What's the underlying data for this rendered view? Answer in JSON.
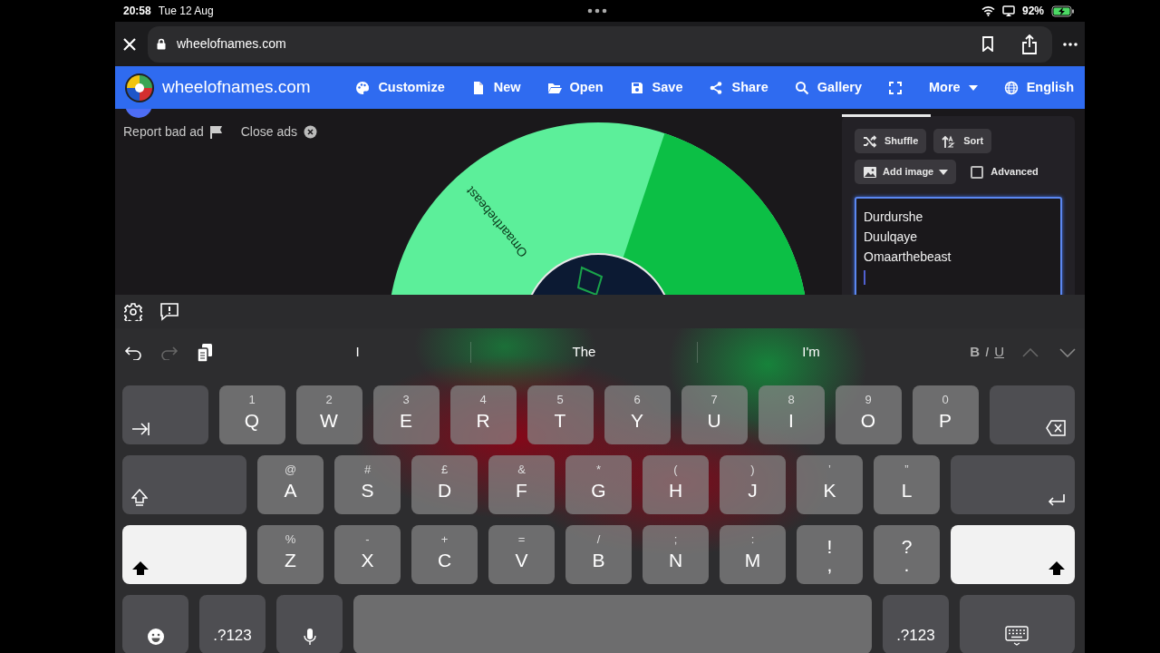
{
  "status_bar": {
    "time": "20:58",
    "date": "Tue 12 Aug",
    "battery": "92%"
  },
  "browser": {
    "url": "wheelofnames.com"
  },
  "site": {
    "logo_text": "wheelofnames.com",
    "menu": [
      {
        "label": "Customize",
        "kind": "palette"
      },
      {
        "label": "New",
        "kind": "file"
      },
      {
        "label": "Open",
        "kind": "folder"
      },
      {
        "label": "Save",
        "kind": "save"
      },
      {
        "label": "Share",
        "kind": "share"
      },
      {
        "label": "Gallery",
        "kind": "search"
      },
      {
        "kind": "fullscreen"
      },
      {
        "label": "More",
        "kind": "more"
      },
      {
        "label": "English",
        "kind": "globe"
      }
    ]
  },
  "ad_bar": [
    {
      "label": "Report bad ad",
      "kind": "flag"
    },
    {
      "label": "Close ads",
      "kind": "close"
    }
  ],
  "wheel": {
    "segments": [
      {
        "label": "Omaarthebeast",
        "color": "#5cef9a"
      },
      {
        "color": "#0cbf45"
      }
    ]
  },
  "editor": {
    "buttons": [
      {
        "label": "Shuffle",
        "kind": "shuffle"
      },
      {
        "label": "Sort",
        "kind": "sort"
      },
      {
        "label": "Add image",
        "kind": "image"
      }
    ],
    "advanced": {
      "label": "Advanced",
      "checked": false
    },
    "entries": [
      "Durdurshe",
      "Duulqaye",
      "Omaarthebeast"
    ]
  },
  "predictions": [
    "I",
    "The",
    "I'm"
  ],
  "format_buttons": [
    {
      "label": "B",
      "kind": "bold"
    },
    {
      "label": "I",
      "kind": "italic"
    },
    {
      "label": "U",
      "kind": "underline"
    }
  ],
  "keyboard": {
    "rows": [
      {
        "keys": [
          {
            "kind": "tab"
          },
          {
            "kind": "letter",
            "label": "Q",
            "sub": "1"
          },
          {
            "kind": "letter",
            "label": "W",
            "sub": "2"
          },
          {
            "kind": "letter",
            "label": "E",
            "sub": "3"
          },
          {
            "kind": "letter",
            "label": "R",
            "sub": "4"
          },
          {
            "kind": "letter",
            "label": "T",
            "sub": "5"
          },
          {
            "kind": "letter",
            "label": "Y",
            "sub": "6"
          },
          {
            "kind": "letter",
            "label": "U",
            "sub": "7"
          },
          {
            "kind": "letter",
            "label": "I",
            "sub": "8"
          },
          {
            "kind": "letter",
            "label": "O",
            "sub": "9"
          },
          {
            "kind": "letter",
            "label": "P",
            "sub": "0"
          },
          {
            "kind": "delete"
          }
        ]
      },
      {
        "keys": [
          {
            "kind": "capslock"
          },
          {
            "kind": "letter",
            "label": "A",
            "sub": "@"
          },
          {
            "kind": "letter",
            "label": "S",
            "sub": "#"
          },
          {
            "kind": "letter",
            "label": "D",
            "sub": "£"
          },
          {
            "kind": "letter",
            "label": "F",
            "sub": "&"
          },
          {
            "kind": "letter",
            "label": "G",
            "sub": "*"
          },
          {
            "kind": "letter",
            "label": "H",
            "sub": "("
          },
          {
            "kind": "letter",
            "label": "J",
            "sub": ")"
          },
          {
            "kind": "letter",
            "label": "K",
            "sub": "’"
          },
          {
            "kind": "letter",
            "label": "L",
            "sub": "”"
          },
          {
            "kind": "return"
          }
        ]
      },
      {
        "keys": [
          {
            "kind": "shift",
            "on": true
          },
          {
            "kind": "letter",
            "label": "Z",
            "sub": "%"
          },
          {
            "kind": "letter",
            "label": "X",
            "sub": "-"
          },
          {
            "kind": "letter",
            "label": "C",
            "sub": "+"
          },
          {
            "kind": "letter",
            "label": "V",
            "sub": "="
          },
          {
            "kind": "letter",
            "label": "B",
            "sub": "/"
          },
          {
            "kind": "letter",
            "label": "N",
            "sub": ";"
          },
          {
            "kind": "letter",
            "label": "M",
            "sub": ":"
          },
          {
            "kind": "punct",
            "label": ",",
            "sub": "!"
          },
          {
            "kind": "punct",
            "label": ".",
            "sub": "?"
          },
          {
            "kind": "shift",
            "on": true
          }
        ]
      },
      {
        "keys": [
          {
            "kind": "emoji"
          },
          {
            "kind": "numbers",
            "label": ".?123"
          },
          {
            "kind": "mic"
          },
          {
            "kind": "space"
          },
          {
            "kind": "numbers",
            "label": ".?123"
          },
          {
            "kind": "hide"
          }
        ]
      }
    ]
  }
}
